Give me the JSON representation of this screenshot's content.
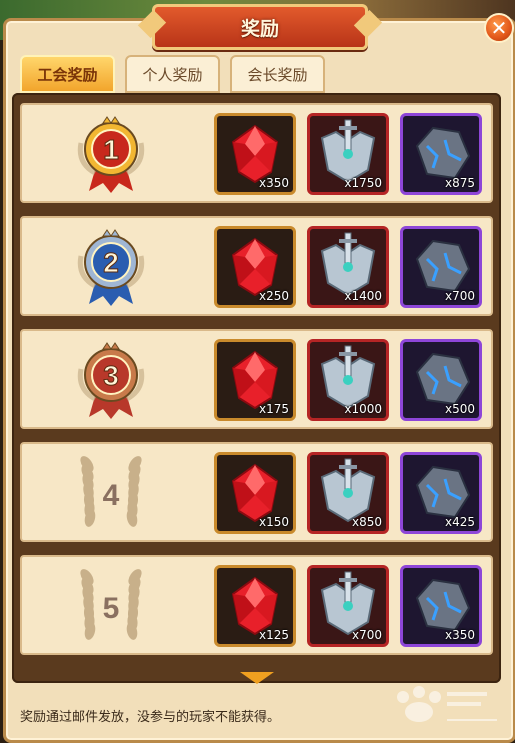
{
  "title": "奖励",
  "tabs": [
    {
      "label": "工会奖励",
      "active": true
    },
    {
      "label": "个人奖励",
      "active": false
    },
    {
      "label": "会长奖励",
      "active": false
    }
  ],
  "ranks": [
    {
      "rank": "1",
      "medal": "gold-medal-icon",
      "items": [
        {
          "icon": "ruby-icon",
          "qty": "x350"
        },
        {
          "icon": "armor-icon",
          "qty": "x1750"
        },
        {
          "icon": "ore-icon",
          "qty": "x875"
        }
      ]
    },
    {
      "rank": "2",
      "medal": "silver-medal-icon",
      "items": [
        {
          "icon": "ruby-icon",
          "qty": "x250"
        },
        {
          "icon": "armor-icon",
          "qty": "x1400"
        },
        {
          "icon": "ore-icon",
          "qty": "x700"
        }
      ]
    },
    {
      "rank": "3",
      "medal": "bronze-medal-icon",
      "items": [
        {
          "icon": "ruby-icon",
          "qty": "x175"
        },
        {
          "icon": "armor-icon",
          "qty": "x1000"
        },
        {
          "icon": "ore-icon",
          "qty": "x500"
        }
      ]
    },
    {
      "rank": "4",
      "medal": "laurel-wreath-icon",
      "items": [
        {
          "icon": "ruby-icon",
          "qty": "x150"
        },
        {
          "icon": "armor-icon",
          "qty": "x850"
        },
        {
          "icon": "ore-icon",
          "qty": "x425"
        }
      ]
    },
    {
      "rank": "5",
      "medal": "laurel-wreath-icon",
      "items": [
        {
          "icon": "ruby-icon",
          "qty": "x125"
        },
        {
          "icon": "armor-icon",
          "qty": "x700"
        },
        {
          "icon": "ore-icon",
          "qty": "x350"
        }
      ]
    }
  ],
  "footer_note": "奖励通过邮件发放，没参与的玩家不能获得。",
  "watermark": "Baidu 经验 jingyan.baidu.com",
  "colors": {
    "gold": "#f2b632",
    "silver": "#9fb6d4",
    "bronze": "#c87a4a",
    "wreath": "#c8b08a"
  }
}
